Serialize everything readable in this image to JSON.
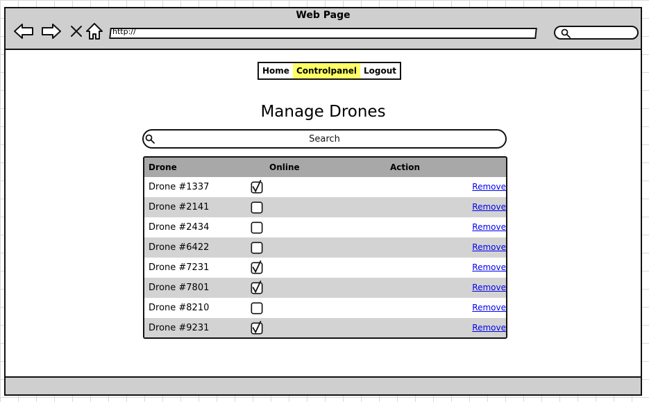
{
  "browser": {
    "title": "Web Page",
    "url": "http://",
    "nav_icons": [
      "back-arrow-icon",
      "forward-arrow-icon",
      "close-icon",
      "home-icon"
    ]
  },
  "menu": {
    "items": [
      {
        "label": "Home",
        "active": false
      },
      {
        "label": "Controlpanel",
        "active": true
      },
      {
        "label": "Logout",
        "active": false
      }
    ],
    "active_color": "#ffff66"
  },
  "page": {
    "title": "Manage Drones",
    "search_placeholder": "Search"
  },
  "table": {
    "headers": {
      "drone": "Drone",
      "online": "Online",
      "action": "Action"
    },
    "rows": [
      {
        "drone": "Drone #1337",
        "online": true,
        "action": "Remove"
      },
      {
        "drone": "Drone #2141",
        "online": false,
        "action": "Remove"
      },
      {
        "drone": "Drone #2434",
        "online": false,
        "action": "Remove"
      },
      {
        "drone": "Drone #6422",
        "online": false,
        "action": "Remove"
      },
      {
        "drone": "Drone #7231",
        "online": true,
        "action": "Remove"
      },
      {
        "drone": "Drone #7801",
        "online": true,
        "action": "Remove"
      },
      {
        "drone": "Drone #8210",
        "online": false,
        "action": "Remove"
      },
      {
        "drone": "Drone #9231",
        "online": true,
        "action": "Remove"
      }
    ]
  },
  "colors": {
    "chrome": "#cfcfcf",
    "header_row": "#a8a8a8",
    "alt_row": "#d3d3d3",
    "link": "#0000ee"
  }
}
